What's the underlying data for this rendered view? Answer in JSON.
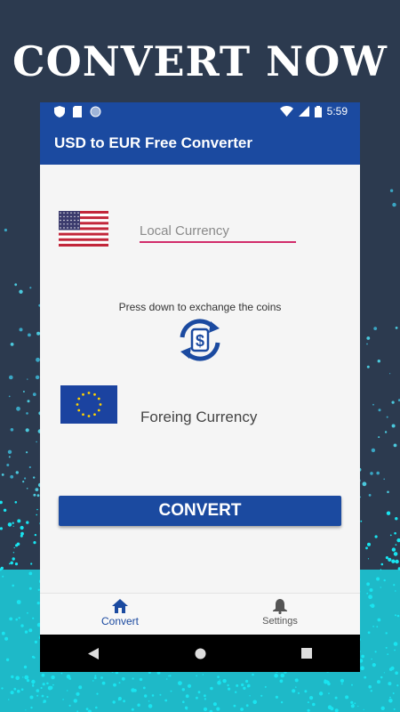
{
  "promo": {
    "title": "CONVERT NOW"
  },
  "status_bar": {
    "time": "5:59"
  },
  "app_bar": {
    "title": "USD to EUR Free Converter"
  },
  "converter": {
    "local_placeholder": "Local Currency",
    "local_value": "",
    "hint": "Press down to exchange the coins",
    "foreign_label": "Foreing Currency",
    "convert_label": "CONVERT",
    "icons": {
      "source_flag": "us-flag-icon",
      "target_flag": "eu-flag-icon",
      "swap": "currency-exchange-icon"
    }
  },
  "bottom_nav": {
    "items": [
      {
        "label": "Convert",
        "icon": "home-icon",
        "active": true
      },
      {
        "label": "Settings",
        "icon": "bell-icon",
        "active": false
      }
    ]
  },
  "colors": {
    "primary": "#1b4aa0",
    "accent": "#d12c6a",
    "background": "#2c3a4f",
    "speckle": "#19e4f0"
  }
}
